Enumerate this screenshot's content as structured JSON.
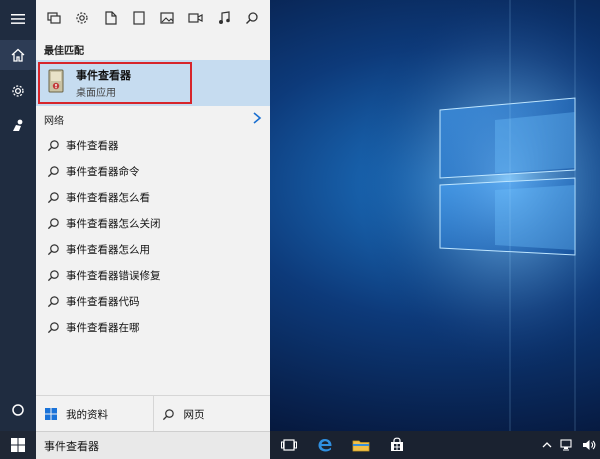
{
  "start_panel": {
    "filters": [
      {
        "icon": "apps-icon"
      },
      {
        "icon": "settings-icon"
      },
      {
        "icon": "document-icon"
      },
      {
        "icon": "folder-icon"
      },
      {
        "icon": "image-icon"
      },
      {
        "icon": "video-icon"
      },
      {
        "icon": "music-icon"
      },
      {
        "icon": "search-icon"
      }
    ],
    "best_match_label": "最佳匹配",
    "best_match": {
      "title": "事件查看器",
      "subtitle": "桌面应用"
    },
    "web_label": "网络",
    "suggestions": [
      "事件查看器",
      "事件查看器命令",
      "事件查看器怎么看",
      "事件查看器怎么关闭",
      "事件查看器怎么用",
      "事件查看器错误修复",
      "事件查看器代码",
      "事件查看器在哪"
    ],
    "bottom": {
      "my_stuff": "我的资料",
      "web": "网页"
    }
  },
  "rail": {
    "icons": [
      "hamburger-icon",
      "home-icon",
      "gear-icon",
      "feedback-icon",
      "cortana-circle-icon"
    ]
  },
  "taskbar": {
    "search_text": "事件查看器",
    "tray": [
      "chevron-up-icon",
      "network-icon",
      "volume-icon"
    ]
  },
  "colors": {
    "panel_bg": "#f2f2f2",
    "highlight": "#c6dcf0",
    "accent_red": "#d7252b",
    "rail_bg": "#1f2c40",
    "taskbar_bg": "#1a2230"
  }
}
